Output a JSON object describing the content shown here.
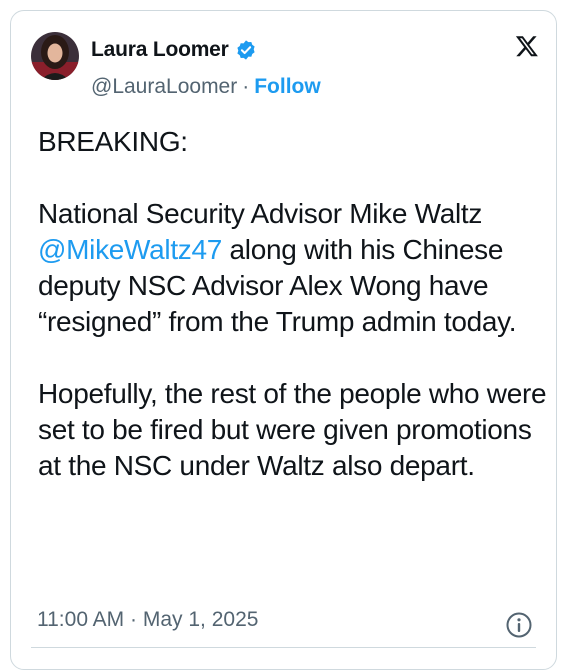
{
  "author": {
    "name": "Laura Loomer",
    "handle": "@LauraLoomer",
    "follow_label": "Follow",
    "verified_color": "#1d9bf0"
  },
  "tweet": {
    "paragraph1": "BREAKING:",
    "paragraph2_before": "National Security Advisor Mike Waltz ",
    "mention": "@MikeWaltz47",
    "paragraph2_after": " along with his Chinese deputy NSC Advisor Alex Wong have “resigned” from the Trump admin today.",
    "paragraph3": "Hopefully, the rest of the people who were set to be fired but were given promotions at the NSC under Waltz also depart."
  },
  "meta": {
    "time": "11:00 AM",
    "separator": "·",
    "date": "May 1, 2025"
  },
  "colors": {
    "accent": "#1d9bf0",
    "secondary_text": "#536471",
    "text": "#0f1419",
    "border": "#cfd9de"
  },
  "icons": [
    "verified-badge-icon",
    "x-logo-icon",
    "info-icon"
  ]
}
